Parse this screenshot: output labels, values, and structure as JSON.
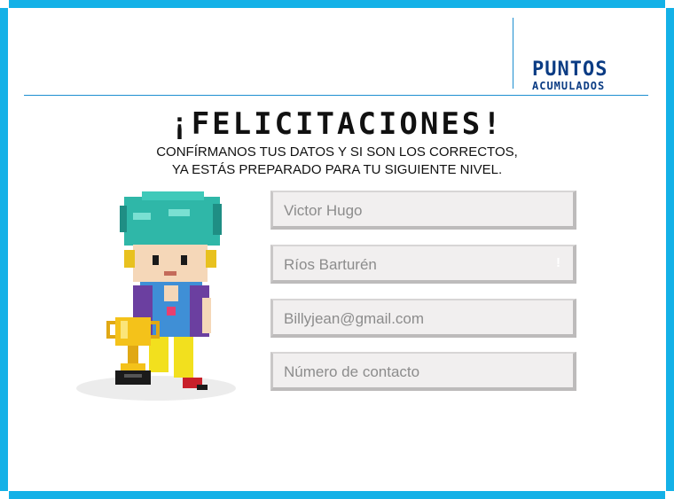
{
  "brand": {
    "line1": "PUNTOS",
    "line2": "ACUMULADOS"
  },
  "heading": {
    "title": "¡FELICITACIONES!",
    "line1": "CONFÍRMANOS TUS DATOS Y SI SON LOS CORRECTOS,",
    "line2": "YA ESTÁS PREPARADO PARA TU SIGUIENTE NIVEL."
  },
  "form": {
    "first_name": "Victor Hugo",
    "last_name": "Ríos Barturén",
    "last_name_warning": "!",
    "email": "Billyjean@gmail.com",
    "phone_placeholder": "Número de contacto"
  },
  "colors": {
    "frame": "#14b1e7",
    "brand": "#0b3c84"
  },
  "icons": {
    "character": "pixel-boy-character",
    "trophy": "trophy-icon"
  }
}
